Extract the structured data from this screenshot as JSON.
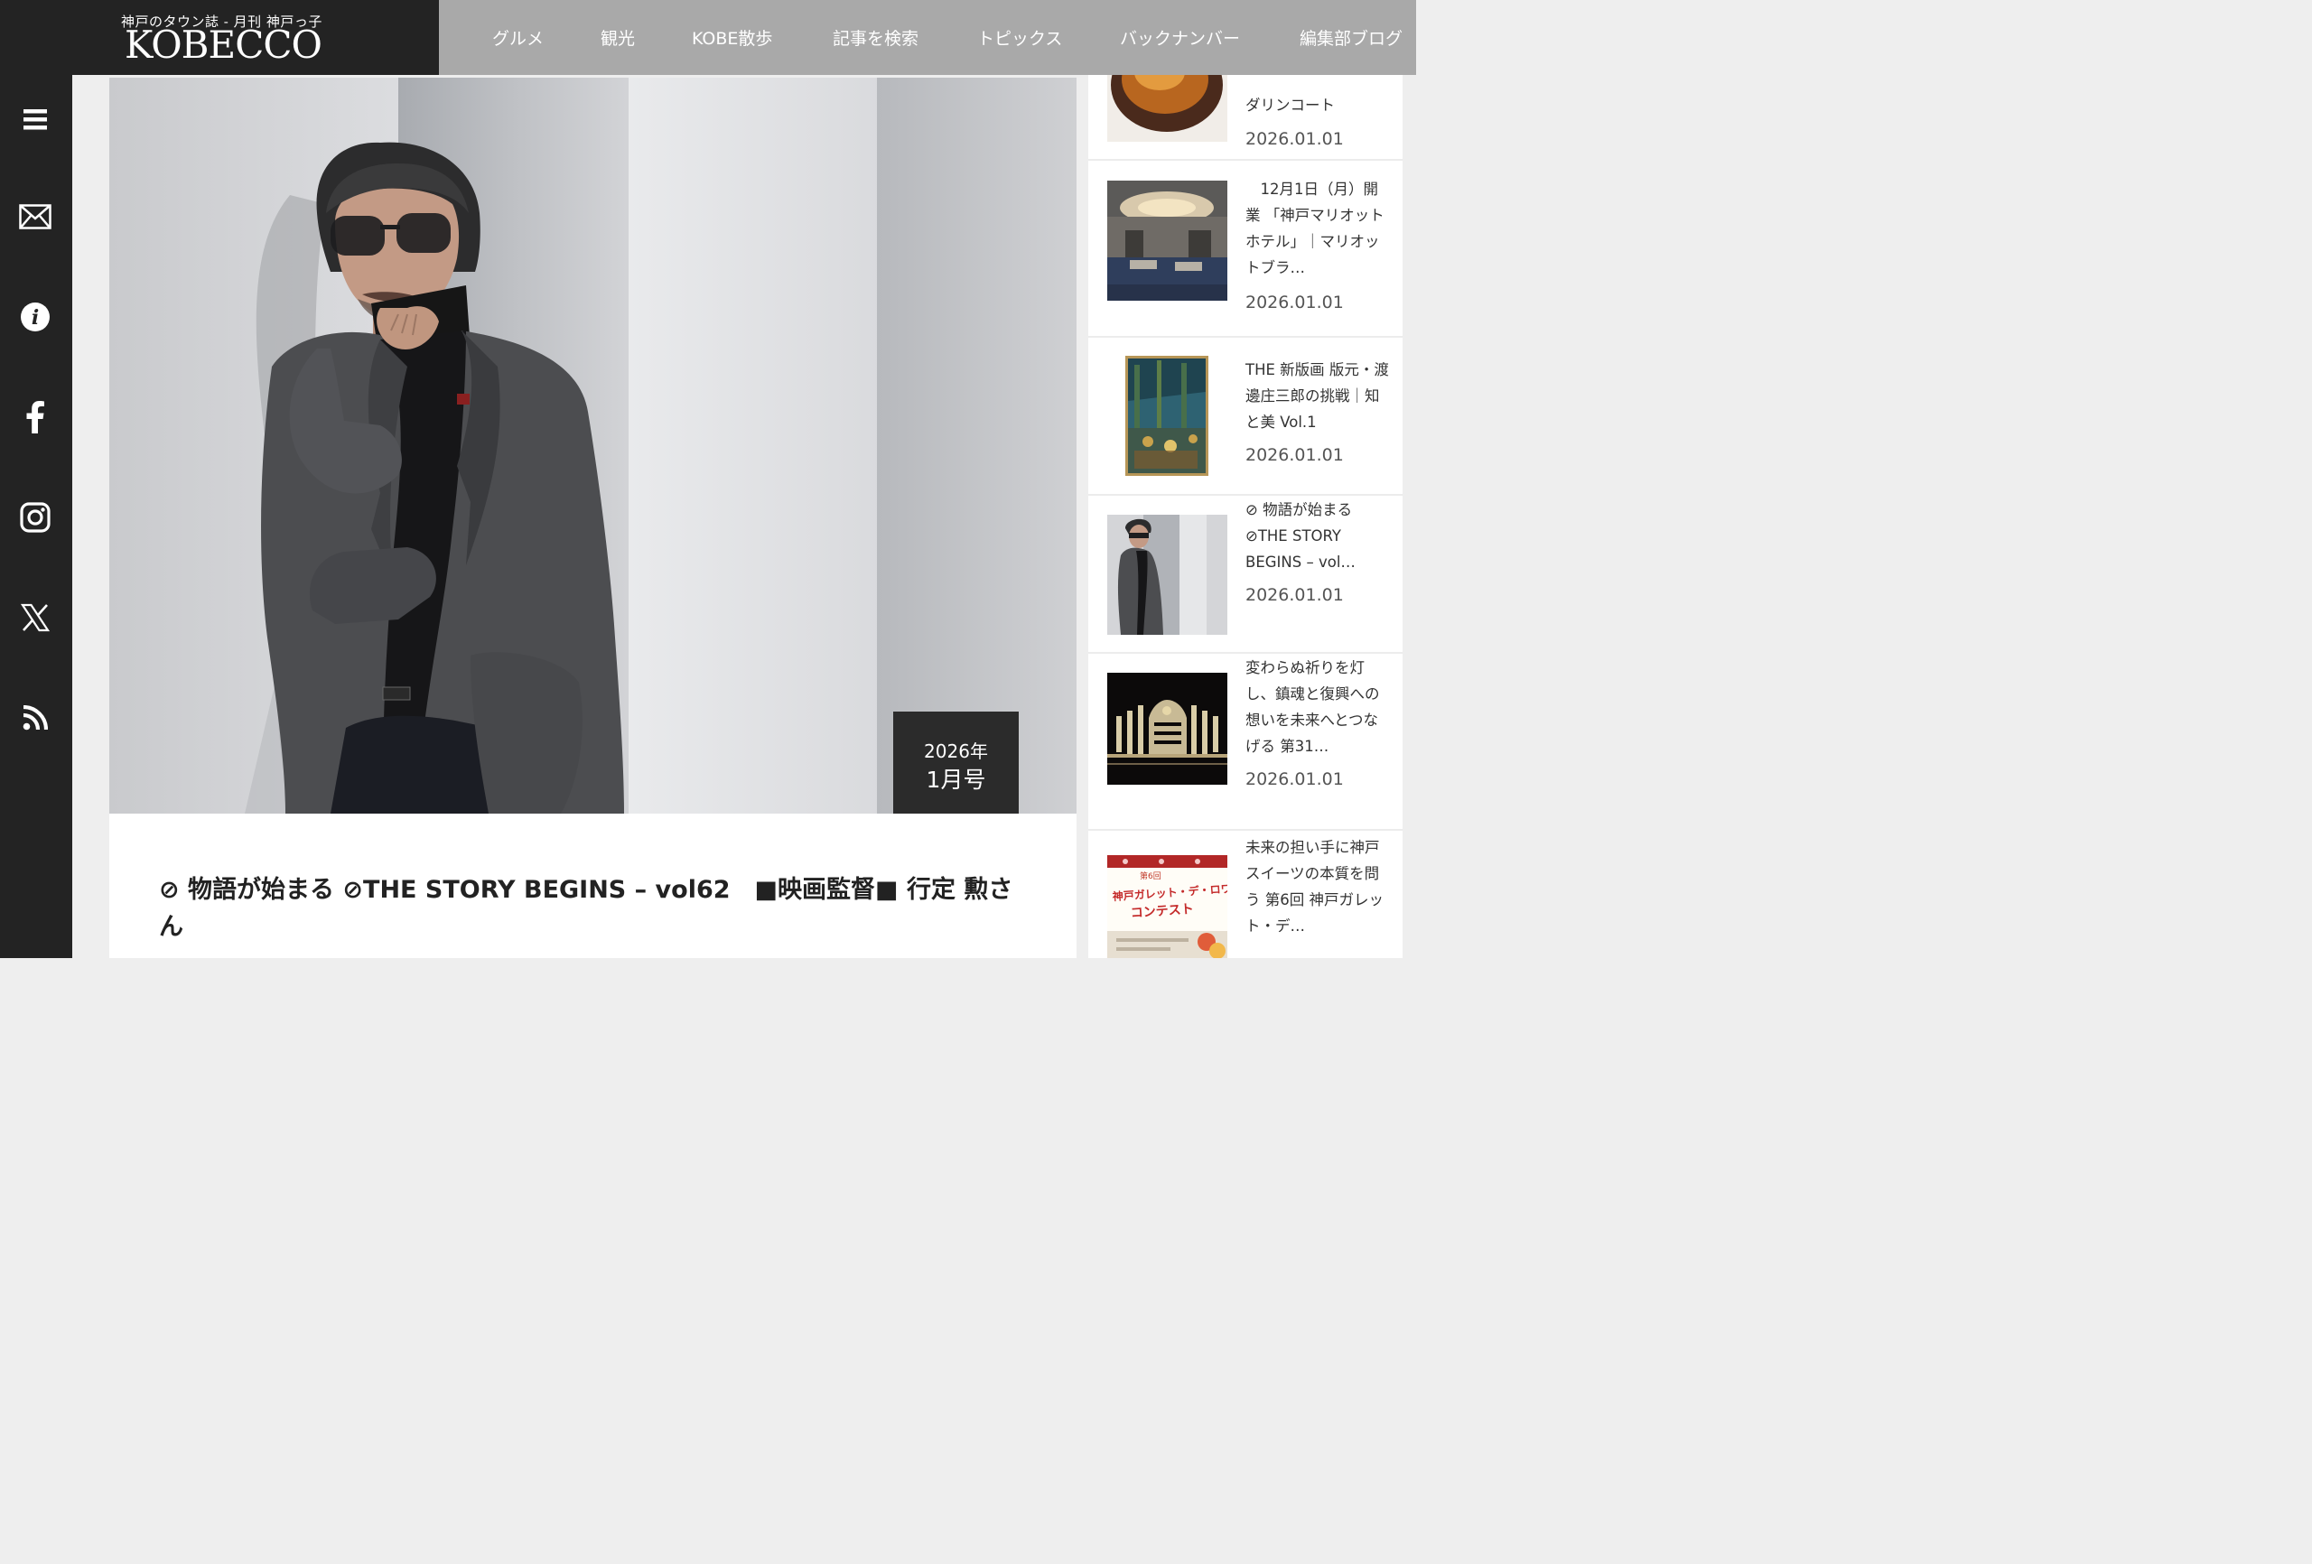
{
  "logo": {
    "subtitle": "神戸のタウン誌 - 月刊 神戸っ子",
    "name": "KOBECCO"
  },
  "nav": [
    {
      "label": "グルメ"
    },
    {
      "label": "観光"
    },
    {
      "label": "KOBE散歩"
    },
    {
      "label": "記事を検索"
    },
    {
      "label": "トピックス"
    },
    {
      "label": "バックナンバー"
    },
    {
      "label": "編集部ブログ"
    }
  ],
  "sidebar": [
    {
      "icon": "menu-icon"
    },
    {
      "icon": "mail-icon"
    },
    {
      "icon": "info-icon"
    },
    {
      "icon": "facebook-icon"
    },
    {
      "icon": "instagram-icon"
    },
    {
      "icon": "x-icon"
    },
    {
      "icon": "rss-icon"
    }
  ],
  "article": {
    "issue_year": "2026年",
    "issue_month": "1月号",
    "title": "⊘ 物語が始まる ⊘THE STORY BEGINS – vol62　■映画監督■ 行定 勲さん"
  },
  "related": [
    {
      "title": "ダリンコート",
      "date": "2026.01.01"
    },
    {
      "title": "　12月1日（月）開業 「神戸マリオットホテル」｜マリオットブラ…",
      "date": "2026.01.01"
    },
    {
      "title": "THE 新版画 版元・渡邊庄三郎の挑戦｜知と美 Vol.1",
      "date": "2026.01.01"
    },
    {
      "title": "⊘ 物語が始まる ⊘THE STORY BEGINS – vol…",
      "date": "2026.01.01"
    },
    {
      "title": "変わらぬ祈りを灯し、鎮魂と復興への想いを未来へとつなげる 第31…",
      "date": "2026.01.01"
    },
    {
      "title": "未来の担い手に神戸スイーツの本質を問う 第6回 神戸ガレット・デ…",
      "date": ""
    }
  ],
  "thumb_text": {
    "contest_badge": "第6回",
    "contest_line1": "神戸ガレット・デ・ロワ",
    "contest_line2": "コンテスト"
  }
}
